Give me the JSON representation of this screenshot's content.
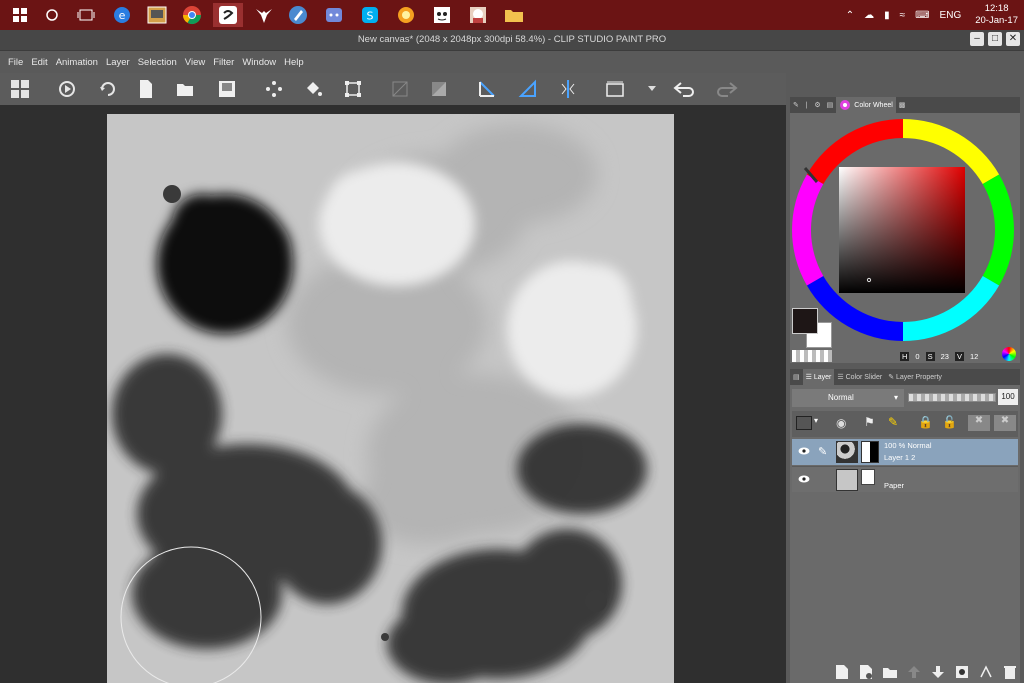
{
  "taskbar": {
    "icons": [
      "windows-start-icon",
      "cortana-icon",
      "task-view-icon",
      "edge-icon",
      "media-app-icon",
      "chrome-icon",
      "clip-studio-icon",
      "fox-app-icon",
      "pen-app-icon",
      "discord-icon",
      "skype-icon",
      "burst-app-icon",
      "doc-viewer-icon",
      "character-app-icon",
      "folder-icon"
    ],
    "tray": {
      "language": "ENG",
      "time": "12:18",
      "date": "20-Jan-17"
    }
  },
  "window": {
    "title": "New canvas* (2048 x 2048px 300dpi 58.4%) - CLIP STUDIO PAINT PRO"
  },
  "menu": [
    "File",
    "Edit",
    "Animation",
    "Layer",
    "Selection",
    "View",
    "Filter",
    "Window",
    "Help"
  ],
  "color_panel": {
    "tab_label": "Color Wheel",
    "hsv": {
      "h": "0",
      "s": "23",
      "v": "12"
    },
    "main_color": "#1e1616",
    "sub_color": "#ffffff"
  },
  "layer_panel": {
    "tabs": [
      "Layer",
      "Color Slider",
      "Layer Property"
    ],
    "blend_mode": "Normal",
    "opacity": "100",
    "layers": [
      {
        "mode": "100 % Normal",
        "name": "Layer 1 2",
        "selected": true
      },
      {
        "mode": "",
        "name": "Paper",
        "selected": false
      }
    ]
  }
}
